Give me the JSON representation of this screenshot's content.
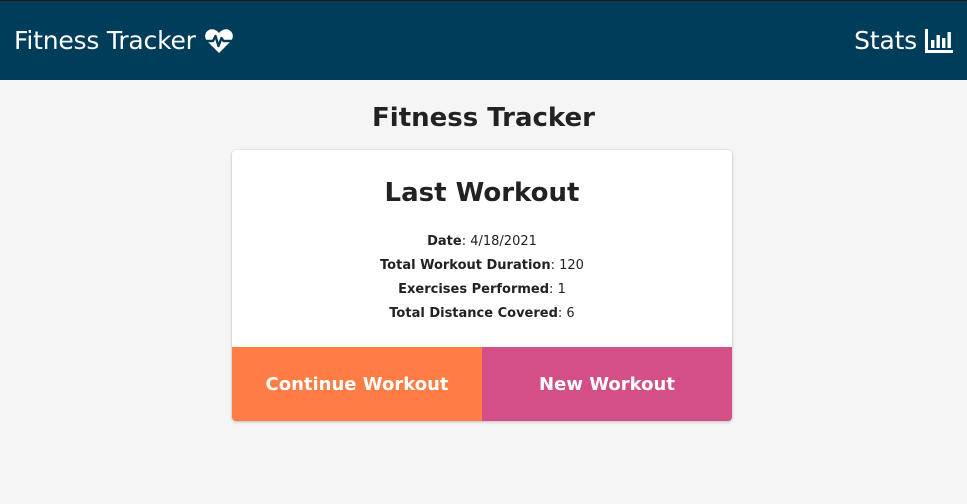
{
  "navbar": {
    "brand_label": "Fitness Tracker",
    "brand_icon": "heartbeat-icon",
    "stats_label": "Stats",
    "stats_icon": "bar-chart-icon",
    "background": "#003d5a"
  },
  "page": {
    "title": "Fitness Tracker"
  },
  "last_workout": {
    "heading": "Last Workout",
    "rows": [
      {
        "label": "Date",
        "value": "4/18/2021"
      },
      {
        "label": "Total Workout Duration",
        "value": "120"
      },
      {
        "label": "Exercises Performed",
        "value": "1"
      },
      {
        "label": "Total Distance Covered",
        "value": "6"
      }
    ],
    "separator": ": "
  },
  "actions": {
    "continue_label": "Continue Workout",
    "continue_color": "#ff7c45",
    "new_label": "New Workout",
    "new_color": "#d54f87"
  }
}
